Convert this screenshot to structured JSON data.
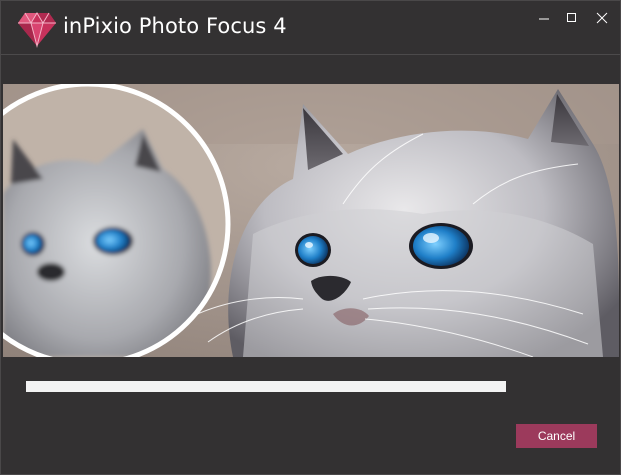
{
  "window": {
    "title": "inPixio Photo Focus 4",
    "logo_icon": "gem-icon",
    "controls": {
      "minimize_icon": "minimize-icon",
      "maximize_icon": "maximize-icon",
      "close_icon": "close-icon"
    }
  },
  "banner": {
    "image": "cat-before-after-illustration"
  },
  "progress": {
    "value_percent": 100
  },
  "actions": {
    "cancel_label": "Cancel"
  },
  "colors": {
    "background": "#333132",
    "accent": "#9c3a5c",
    "logo": "#c8325c",
    "progress": "#f3f3f3"
  }
}
